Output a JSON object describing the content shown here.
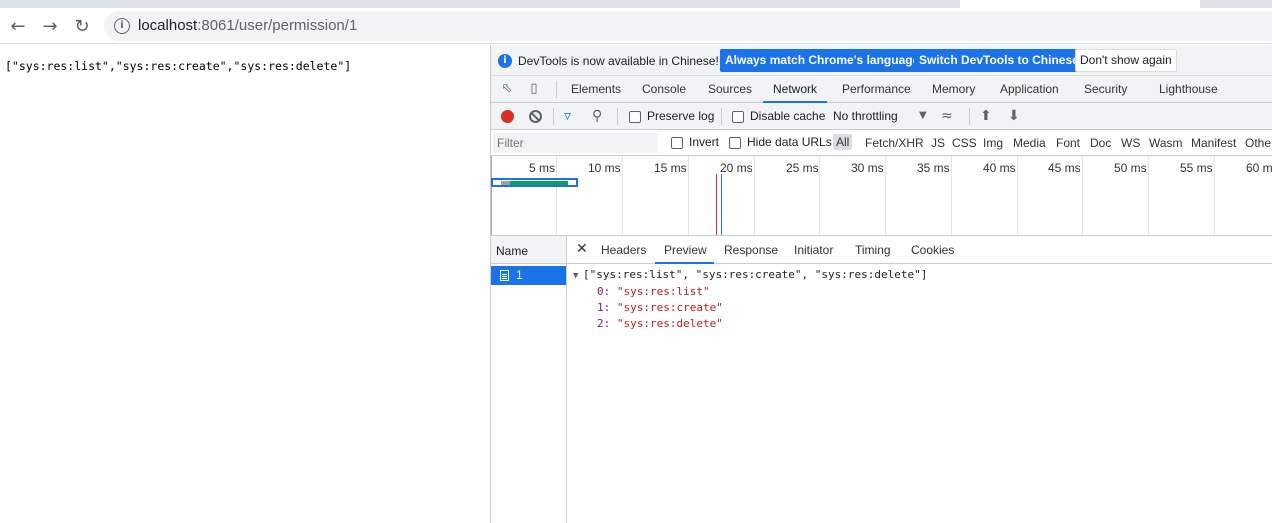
{
  "browser": {
    "url_host": "localhost",
    "url_path": ":8061/user/permission/1"
  },
  "page": {
    "body_text": "[\"sys:res:list\",\"sys:res:create\",\"sys:res:delete\"]"
  },
  "devtools": {
    "infobar": {
      "message": "DevTools is now available in Chinese!",
      "match_button": "Always match Chrome's language",
      "switch_button": "Switch DevTools to Chinese",
      "dismiss_button": "Don't show again"
    },
    "tabs": [
      "Elements",
      "Console",
      "Sources",
      "Network",
      "Performance",
      "Memory",
      "Application",
      "Security",
      "Lighthouse"
    ],
    "active_tab": "Network",
    "network_toolbar": {
      "preserve_log": "Preserve log",
      "disable_cache": "Disable cache",
      "throttling": "No throttling"
    },
    "filter": {
      "placeholder": "Filter",
      "invert": "Invert",
      "hide_data_urls": "Hide data URLs",
      "types": [
        "All",
        "Fetch/XHR",
        "JS",
        "CSS",
        "Img",
        "Media",
        "Font",
        "Doc",
        "WS",
        "Wasm",
        "Manifest",
        "Othe"
      ]
    },
    "timeline_ticks": [
      "5 ms",
      "10 ms",
      "15 ms",
      "20 ms",
      "25 ms",
      "30 ms",
      "35 ms",
      "40 ms",
      "45 ms",
      "50 ms",
      "55 ms",
      "60 m"
    ],
    "requests": {
      "name_header": "Name",
      "items": [
        "1"
      ]
    },
    "detail_tabs": [
      "Headers",
      "Preview",
      "Response",
      "Initiator",
      "Timing",
      "Cookies"
    ],
    "active_detail_tab": "Preview",
    "preview": {
      "summary": "[\"sys:res:list\", \"sys:res:create\", \"sys:res:delete\"]",
      "entries": [
        {
          "index": "0:",
          "value": "\"sys:res:list\""
        },
        {
          "index": "1:",
          "value": "\"sys:res:create\""
        },
        {
          "index": "2:",
          "value": "\"sys:res:delete\""
        }
      ]
    }
  },
  "colors": {
    "accent": "#1a73e8",
    "record": "#d93025",
    "json_string": "#c41a16",
    "json_index": "#881280"
  }
}
